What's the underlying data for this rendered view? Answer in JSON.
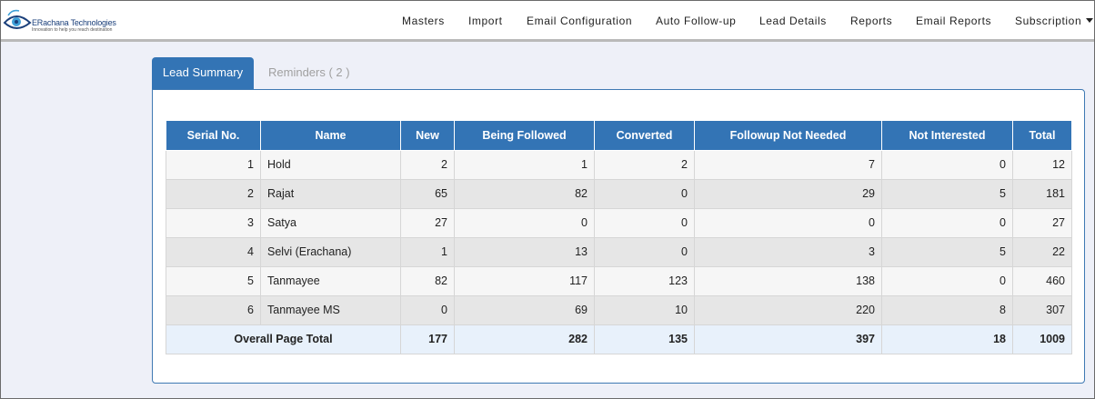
{
  "brand": {
    "name": "ERachana Technologies",
    "tagline": "Innovation to help you reach destination"
  },
  "nav": {
    "items": [
      "Masters",
      "Import",
      "Email Configuration",
      "Auto Follow-up",
      "Lead Details",
      "Reports",
      "Email Reports",
      "Subscription"
    ]
  },
  "tabs": {
    "lead_summary": "Lead Summary",
    "reminders": "Reminders ( 2 )"
  },
  "table": {
    "headers": [
      "Serial No.",
      "Name",
      "New",
      "Being Followed",
      "Converted",
      "Followup Not Needed",
      "Not Interested",
      "Total"
    ],
    "rows": [
      [
        "1",
        "Hold",
        "2",
        "1",
        "2",
        "7",
        "0",
        "12"
      ],
      [
        "2",
        "Rajat",
        "65",
        "82",
        "0",
        "29",
        "5",
        "181"
      ],
      [
        "3",
        "Satya",
        "27",
        "0",
        "0",
        "0",
        "0",
        "27"
      ],
      [
        "4",
        "Selvi (Erachana)",
        "1",
        "13",
        "0",
        "3",
        "5",
        "22"
      ],
      [
        "5",
        "Tanmayee",
        "82",
        "117",
        "123",
        "138",
        "0",
        "460"
      ],
      [
        "6",
        "Tanmayee MS",
        "0",
        "69",
        "10",
        "220",
        "8",
        "307"
      ]
    ],
    "total": {
      "label": "Overall Page Total",
      "values": [
        "177",
        "282",
        "135",
        "397",
        "18",
        "1009"
      ]
    }
  },
  "colors": {
    "accent": "#3374b5",
    "page_bg": "#eef0f8"
  }
}
